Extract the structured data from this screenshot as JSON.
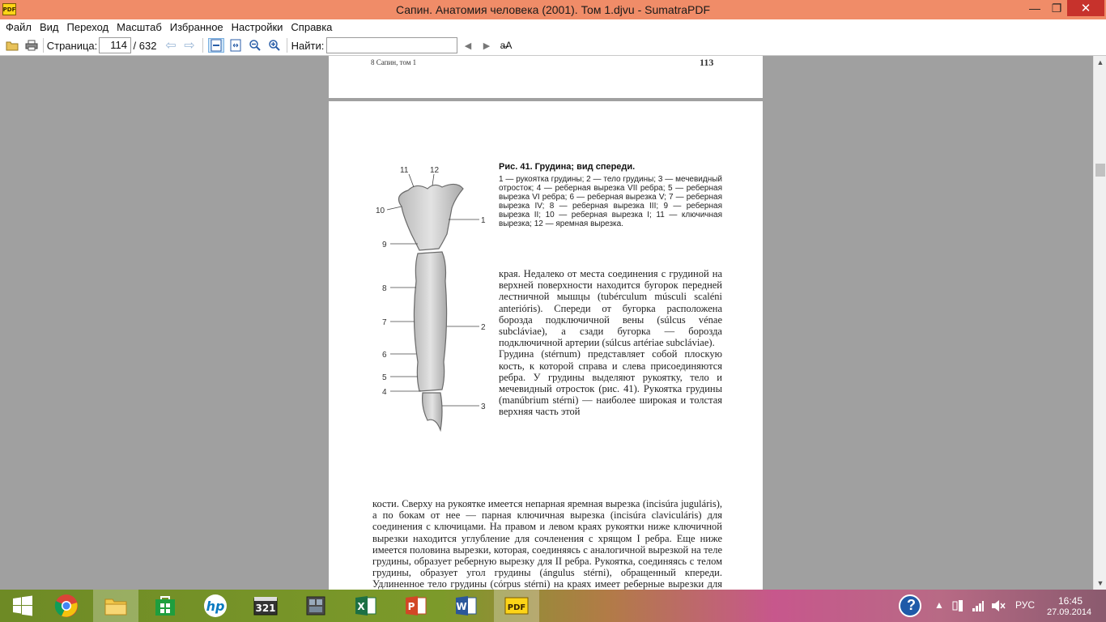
{
  "window": {
    "title": "Сапин. Анатомия человека (2001). Том 1.djvu - SumatraPDF",
    "app_icon_text": "PDF",
    "minimize_glyph": "—",
    "maximize_glyph": "❐",
    "close_glyph": "✕"
  },
  "menu": {
    "items": [
      "Файл",
      "Вид",
      "Переход",
      "Масштаб",
      "Избранное",
      "Настройки",
      "Справка"
    ]
  },
  "toolbar": {
    "page_label": "Страница:",
    "page_value": "114",
    "page_total": "/ 632",
    "find_label": "Найти:",
    "find_value": "",
    "match_case_glyph": "a̶A"
  },
  "document": {
    "running_head": "8 Сапин, том 1",
    "page_number": "113",
    "figure_labels": [
      "11",
      "12",
      "10",
      "1",
      "9",
      "8",
      "7",
      "2",
      "6",
      "5",
      "4",
      "3"
    ],
    "caption_title": "Рис. 41. Грудина; вид спереди.",
    "caption_body": "1 — рукоятка грудины; 2 — тело грудины; 3 — мечевидный отросток; 4 — реберная вырезка VII ребра; 5 — реберная вырезка VI ребра; 6 — реберная вырезка V; 7 — реберная вырезка IV; 8 — реберная вырезка III; 9 — реберная вырезка II; 10 — реберная вырезка I; 11 — ключичная вырезка; 12 — яремная вырезка.",
    "para_side": "края. Недалеко от места соединения с грудиной на верхней поверхности находится бугорок передней лестничной мышцы (tubérculum músculi scaléni anterióris). Спереди от бугорка расположена борозда подключичной вены (súlcus vénae subcláviae), а сзади бугорка — борозда подключичной артерии (súlcus artériae subcláviae).\n      Грудина (stérnum) представляет собой плоскую кость, к которой справа и слева присоединяются ребра. У грудины выделяют рукоятку, тело и мечевидный отросток (рис. 41). Рукоятка грудины (manúbrium stérni) — наиболее широкая и толстая верхняя часть этой",
    "para_full": "кости. Сверху на рукоятке имеется непарная яремная вырезка (incisúra juguláris), а по бокам от нее — парная ключичная вырезка (incisúra claviculáris) для соединения с ключицами. На правом и левом краях рукоятки ниже ключичной вырезки находится углубление для сочленения с хрящом I ребра. Еще ниже имеется половина вырезки, которая, соединяясь с аналогичной вырезкой на теле грудины, образует реберную вырезку для II ребра. Рукоятка, соединяясь с телом грудины, образует угол грудины (ángulus stérni), обращенный кпереди. Удлиненное тело грудины (córpus stérni) на краях имеет реберные вырезки для сочленения с хрящами истинных ребер. Реберная вырезка для VII ребра находится между телом грудины и мечевидным"
  },
  "taskbar": {
    "apps": [
      "windows-start",
      "chrome",
      "file-explorer",
      "store",
      "hp",
      "media-player-321",
      "app-window",
      "excel",
      "powerpoint",
      "word",
      "sumatrapdf"
    ],
    "tray": {
      "help_glyph": "?",
      "language": "РУС",
      "time": "16:45",
      "date": "27.09.2014"
    }
  }
}
